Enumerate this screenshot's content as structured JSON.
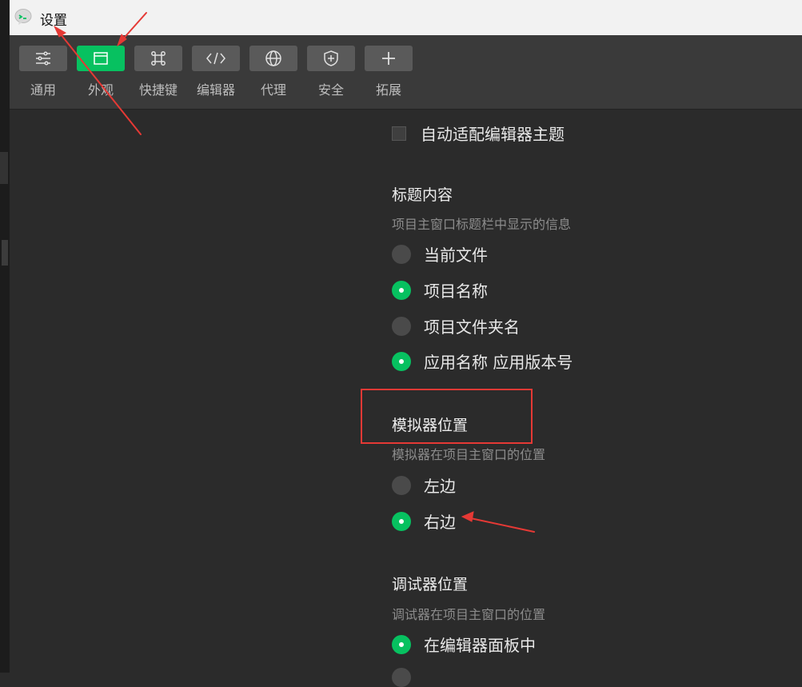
{
  "window": {
    "title": "设置"
  },
  "toolbar": {
    "tabs": [
      {
        "label": "通用",
        "icon": "sliders-icon",
        "active": false
      },
      {
        "label": "外观",
        "icon": "window-icon",
        "active": true
      },
      {
        "label": "快捷键",
        "icon": "command-icon",
        "active": false
      },
      {
        "label": "编辑器",
        "icon": "code-icon",
        "active": false
      },
      {
        "label": "代理",
        "icon": "globe-icon",
        "active": false
      },
      {
        "label": "安全",
        "icon": "shield-plus-icon",
        "active": false
      },
      {
        "label": "拓展",
        "icon": "plus-icon",
        "active": false
      }
    ]
  },
  "settings": {
    "auto_theme": {
      "label": "自动适配编辑器主题",
      "checked": false
    },
    "title_content": {
      "title": "标题内容",
      "description": "项目主窗口标题栏中显示的信息",
      "options": [
        {
          "label": "当前文件",
          "checked": false
        },
        {
          "label": "项目名称",
          "checked": true
        },
        {
          "label": "项目文件夹名",
          "checked": false
        },
        {
          "label": "应用名称 应用版本号",
          "checked": true
        }
      ]
    },
    "simulator_position": {
      "title": "模拟器位置",
      "description": "模拟器在项目主窗口的位置",
      "options": [
        {
          "label": "左边",
          "checked": false
        },
        {
          "label": "右边",
          "checked": true
        }
      ]
    },
    "debugger_position": {
      "title": "调试器位置",
      "description": "调试器在项目主窗口的位置",
      "options": [
        {
          "label": "在编辑器面板中",
          "checked": true
        }
      ]
    }
  },
  "colors": {
    "accent": "#07c160",
    "annotation": "#e53935",
    "background": "#2b2b2b",
    "toolbar": "#3a3a3a"
  }
}
